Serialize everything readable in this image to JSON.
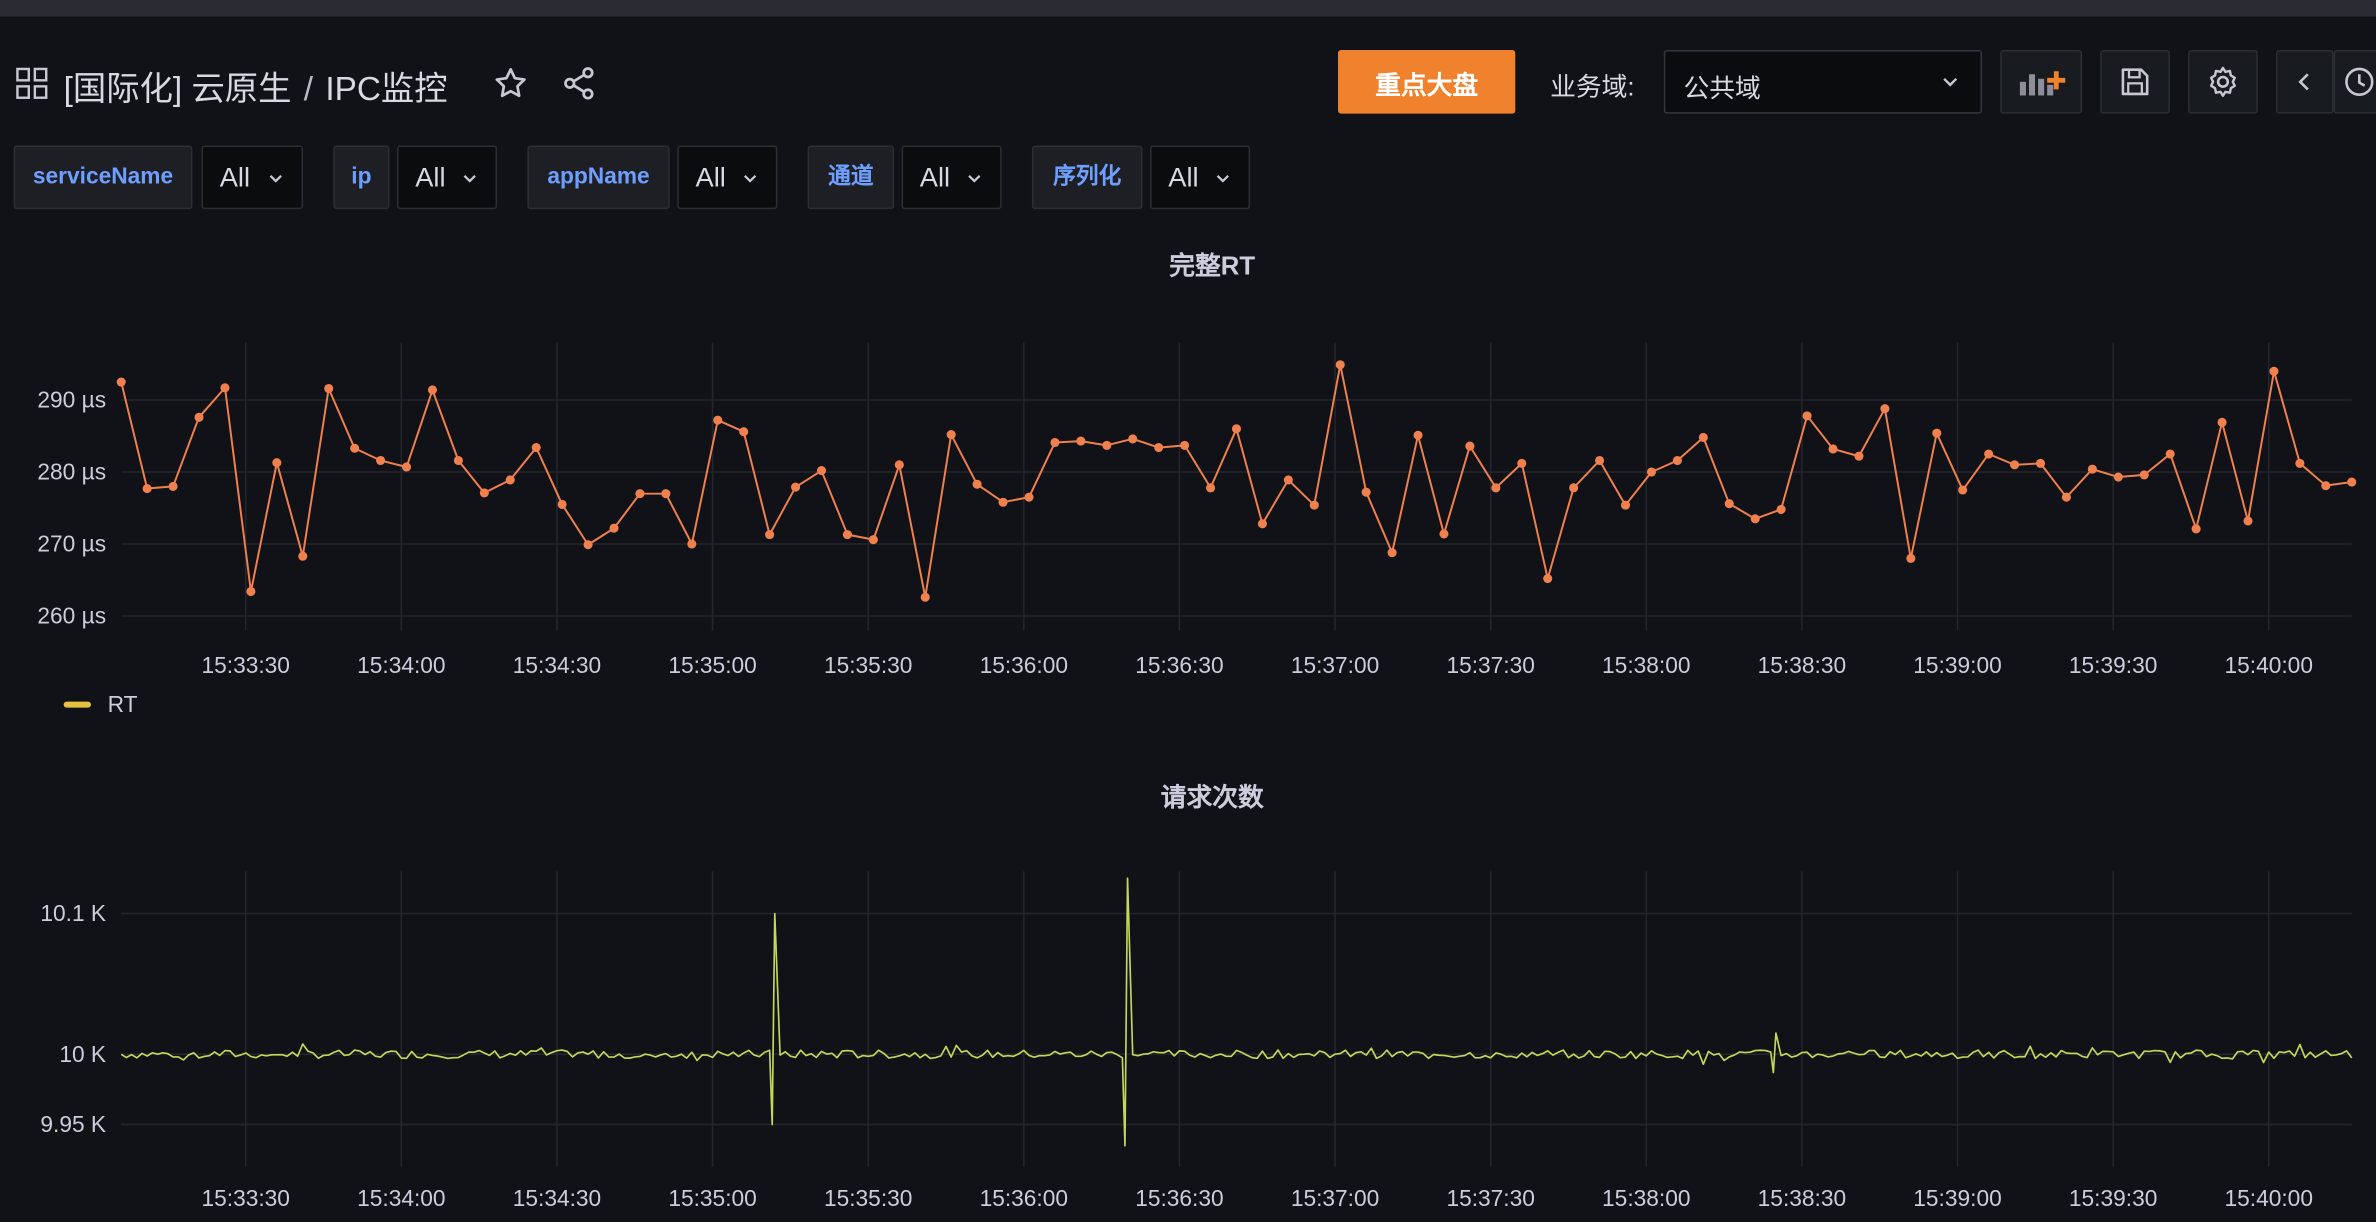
{
  "navbar": {
    "breadcrumb_folder": "[国际化] 云原生",
    "breadcrumb_separator": "/",
    "breadcrumb_dashboard": "IPC监控",
    "primary_button": "重点大盘",
    "domain_label": "业务域:",
    "domain_value": "公共域",
    "icons": [
      "apps-icon",
      "star-icon",
      "share-icon",
      "chevron-down-icon",
      "add-panel-icon",
      "save-icon",
      "gear-icon",
      "chevron-left-icon",
      "clock-icon"
    ]
  },
  "variables": [
    {
      "name": "serviceName",
      "value": "All"
    },
    {
      "name": "ip",
      "value": "All"
    },
    {
      "name": "appName",
      "value": "All"
    },
    {
      "name": "通道",
      "value": "All"
    },
    {
      "name": "序列化",
      "value": "All"
    }
  ],
  "colors": {
    "background": "#111217",
    "accent": "#f0812d",
    "series_rt": "#f0814e",
    "legend_rt": "#e8c23e",
    "series_requests": "#c1d85a",
    "variable_label": "#6e9fff",
    "grid": "#24262d"
  },
  "chart_data": [
    {
      "type": "line",
      "title": "完整RT",
      "y_ticks": [
        "260 µs",
        "270 µs",
        "280 µs",
        "290 µs"
      ],
      "ylim": [
        258,
        298
      ],
      "x_ticks": [
        "15:33:30",
        "15:34:00",
        "15:34:30",
        "15:35:00",
        "15:35:30",
        "15:36:00",
        "15:36:30",
        "15:37:00",
        "15:37:30",
        "15:38:00",
        "15:38:30",
        "15:39:00",
        "15:39:30",
        "15:40:00"
      ],
      "x_range": [
        "15:33:06",
        "15:40:16"
      ],
      "legend": [
        "RT"
      ],
      "legend_placement": "bottom-left",
      "points_shown": true,
      "series": [
        {
          "name": "RT",
          "color": "#f0814e",
          "values": [
            292.5,
            277.7,
            278.0,
            287.6,
            291.7,
            263.4,
            281.3,
            268.3,
            291.6,
            283.3,
            281.6,
            280.7,
            291.4,
            281.6,
            277.1,
            278.9,
            283.4,
            275.5,
            269.9,
            272.2,
            277.0,
            277.0,
            270.0,
            287.2,
            285.6,
            271.3,
            277.9,
            280.2,
            271.3,
            270.6,
            281.0,
            262.6,
            285.2,
            278.3,
            275.8,
            276.5,
            284.1,
            284.3,
            283.7,
            284.6,
            283.4,
            283.7,
            277.8,
            286.0,
            272.8,
            278.9,
            275.4,
            294.9,
            277.2,
            268.8,
            285.1,
            271.4,
            283.6,
            277.8,
            281.2,
            265.2,
            277.8,
            281.6,
            275.4,
            280.0,
            281.6,
            284.8,
            275.6,
            273.5,
            274.8,
            287.8,
            283.2,
            282.2,
            288.8,
            268.0,
            285.4,
            277.5,
            282.5,
            281.0,
            281.2,
            276.5,
            280.4,
            279.3,
            279.6,
            282.5,
            272.1,
            286.9,
            273.2,
            294.0,
            281.2,
            278.1,
            278.6
          ]
        }
      ]
    },
    {
      "type": "line",
      "title": "请求次数",
      "y_ticks": [
        "9.95 K",
        "10 K",
        "10.1 K"
      ],
      "ylim": [
        9920,
        10130
      ],
      "x_ticks": [
        "15:33:30",
        "15:34:00",
        "15:34:30",
        "15:35:00",
        "15:35:30",
        "15:36:00",
        "15:36:30",
        "15:37:00",
        "15:37:30",
        "15:38:00",
        "15:38:30",
        "15:39:00",
        "15:39:30",
        "15:40:00"
      ],
      "x_range": [
        "15:33:06",
        "15:40:16"
      ],
      "points_shown": false,
      "baseline_approx": 10000,
      "spikes": [
        {
          "time": "15:35:12",
          "max": 10100,
          "min": 9950
        },
        {
          "time": "15:36:20",
          "max": 10125,
          "min": 9935
        },
        {
          "time": "15:38:25",
          "max": 10015,
          "min": 9987
        }
      ],
      "series": [
        {
          "name": "",
          "color": "#c1d85a"
        }
      ]
    }
  ]
}
